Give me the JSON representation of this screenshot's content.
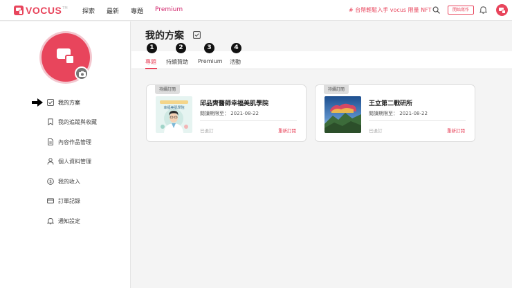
{
  "header": {
    "logo_text": "VOCUS",
    "logo_tm": "TM",
    "nav": [
      "探索",
      "最新",
      "專題",
      "Premium"
    ],
    "promo": "# 台幣輕鬆入手 vocus 限量 NFT",
    "start_writing": "開始寫作"
  },
  "sidebar": {
    "items": [
      {
        "label": "我的方案",
        "icon": "check-square-icon"
      },
      {
        "label": "我的追蹤與收藏",
        "icon": "bookmark-icon"
      },
      {
        "label": "內容作品管理",
        "icon": "document-icon"
      },
      {
        "label": "個人資料管理",
        "icon": "user-icon"
      },
      {
        "label": "我的收入",
        "icon": "dollar-circle-icon"
      },
      {
        "label": "訂單記錄",
        "icon": "credit-card-icon"
      },
      {
        "label": "通知設定",
        "icon": "bell-icon"
      }
    ]
  },
  "main": {
    "title": "我的方案",
    "tabs": [
      {
        "badge": "1",
        "label": "專題"
      },
      {
        "badge": "2",
        "label": "持續贊助"
      },
      {
        "badge": "3",
        "label": "Premium"
      },
      {
        "badge": "4",
        "label": "活動"
      }
    ],
    "cards": [
      {
        "tag": "持續訂閱",
        "title": "邱品齊醫師幸福美肌學院",
        "date": "閱讀期限至： 2021-08-22",
        "status": "已退訂",
        "action": "重新訂閱",
        "thumb_text": "幸福美肌學院"
      },
      {
        "tag": "持續訂閱",
        "title": "王立第二戰研所",
        "date": "閱讀期限至： 2021-08-22",
        "status": "已退訂",
        "action": "重新訂閱"
      }
    ]
  },
  "colors": {
    "accent": "#e8455c",
    "premium": "#d1256c"
  }
}
